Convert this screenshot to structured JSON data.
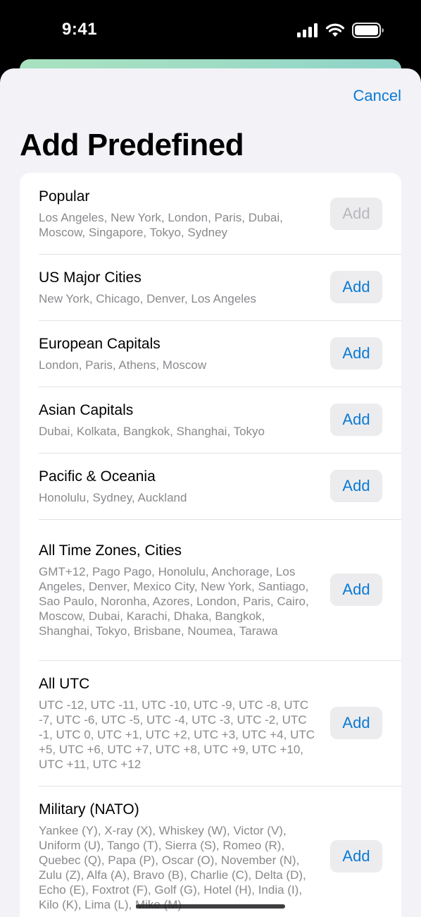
{
  "status_bar": {
    "time": "9:41",
    "icons": [
      "cellular-signal-icon",
      "wifi-icon",
      "battery-icon"
    ]
  },
  "header": {
    "cancel_label": "Cancel",
    "title": "Add Predefined"
  },
  "accent_color": "#0a7ad4",
  "rows": [
    {
      "title": "Popular",
      "subtitle": "Los Angeles, New York, London, Paris, Dubai, Moscow, Singapore, Tokyo, Sydney",
      "button_label": "Add",
      "button_enabled": false
    },
    {
      "title": "US Major Cities",
      "subtitle": "New York, Chicago, Denver, Los Angeles",
      "button_label": "Add",
      "button_enabled": true
    },
    {
      "title": "European Capitals",
      "subtitle": "London, Paris, Athens, Moscow",
      "button_label": "Add",
      "button_enabled": true
    },
    {
      "title": "Asian Capitals",
      "subtitle": "Dubai, Kolkata, Bangkok, Shanghai, Tokyo",
      "button_label": "Add",
      "button_enabled": true
    },
    {
      "title": "Pacific & Oceania",
      "subtitle": "Honolulu, Sydney, Auckland",
      "button_label": "Add",
      "button_enabled": true
    },
    {
      "title": "All Time Zones, Cities",
      "subtitle": "GMT+12, Pago Pago, Honolulu, Anchorage, Los Angeles, Denver, Mexico City, New York, Santiago, Sao Paulo, Noronha, Azores, London, Paris, Cairo, Moscow, Dubai, Karachi, Dhaka, Bangkok, Shanghai, Tokyo, Brisbane, Noumea, Tarawa",
      "button_label": "Add",
      "button_enabled": true
    },
    {
      "title": "All UTC",
      "subtitle": "UTC -12, UTC -11, UTC -10, UTC -9, UTC -8, UTC -7, UTC -6, UTC -5, UTC -4, UTC -3, UTC -2, UTC -1, UTC 0, UTC +1, UTC +2, UTC +3, UTC +4, UTC +5, UTC +6, UTC +7, UTC +8, UTC +9, UTC +10, UTC +11, UTC +12",
      "button_label": "Add",
      "button_enabled": true
    },
    {
      "title": "Military (NATO)",
      "subtitle": "Yankee (Y), X-ray (X), Whiskey (W), Victor (V), Uniform (U), Tango (T), Sierra (S), Romeo (R), Quebec (Q), Papa (P), Oscar (O), November (N), Zulu (Z), Alfa (A), Bravo (B), Charlie (C), Delta (D), Echo (E), Foxtrot (F), Golf (G), Hotel (H), India (I), Kilo (K), Lima (L), Mike (M)",
      "button_label": "Add",
      "button_enabled": true
    }
  ]
}
